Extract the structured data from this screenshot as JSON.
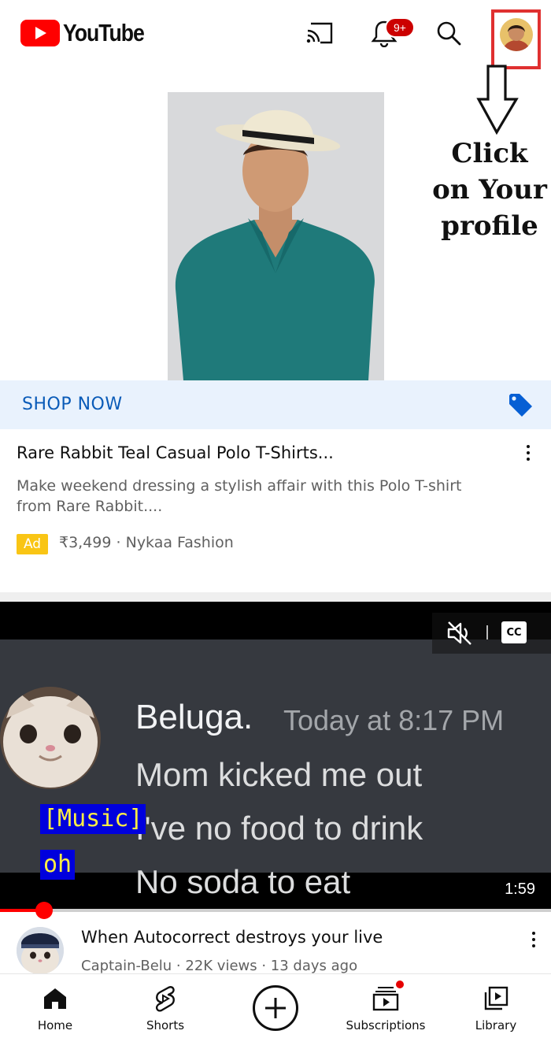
{
  "header": {
    "logo_text": "YouTube",
    "notification_badge": "9+",
    "brand_color": "#ff0000"
  },
  "annotation": {
    "lines": [
      "Click",
      "on Your",
      "profile"
    ],
    "highlight_color": "#e03030"
  },
  "ad": {
    "shop_label": "SHOP NOW",
    "title": "Rare Rabbit Teal Casual Polo T-Shirts...",
    "description": "Make weekend dressing a stylish affair with this Polo T-shirt from Rare Rabbit....",
    "badge": "Ad",
    "meta": "₹3,499 · Nykaa Fashion",
    "product_color": "#1f7a7a"
  },
  "video": {
    "discord_name": "Beluga.",
    "discord_time": "Today at 8:17 PM",
    "lines": [
      "Mom kicked me out",
      "I've no food to drink",
      "No soda to eat"
    ],
    "captions": [
      "[Music]",
      "oh"
    ],
    "cc_label": "CC",
    "duration": "1:59",
    "progress_fraction": 0.08,
    "title": "When Autocorrect destroys your live",
    "meta": "Captain-Belu · 22K views · 13 days ago"
  },
  "nav": {
    "items": [
      {
        "label": "Home",
        "icon": "home-icon"
      },
      {
        "label": "Shorts",
        "icon": "shorts-icon"
      },
      {
        "label": "",
        "icon": "create-icon"
      },
      {
        "label": "Subscriptions",
        "icon": "subscriptions-icon"
      },
      {
        "label": "Library",
        "icon": "library-icon"
      }
    ]
  }
}
